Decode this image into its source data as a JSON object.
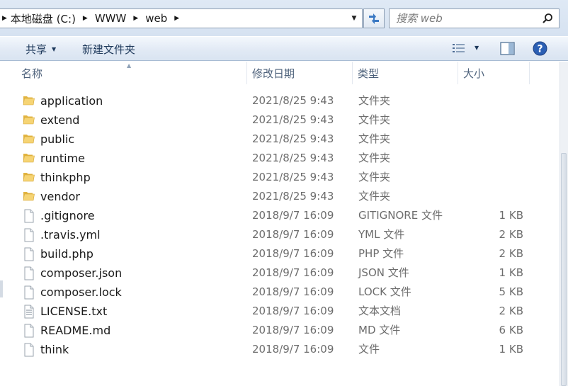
{
  "address_bar": {
    "crumbs": [
      "本地磁盘 (C:)",
      "WWW",
      "web"
    ]
  },
  "search": {
    "placeholder": "搜索 web"
  },
  "toolbar": {
    "share_label": "共享",
    "new_folder_label": "新建文件夹"
  },
  "columns": {
    "name": "名称",
    "date": "修改日期",
    "type": "类型",
    "size": "大小"
  },
  "files": [
    {
      "name": "application",
      "date": "2021/8/25 9:43",
      "type": "文件夹",
      "size": "",
      "icon": "folder-icon"
    },
    {
      "name": "extend",
      "date": "2021/8/25 9:43",
      "type": "文件夹",
      "size": "",
      "icon": "folder-icon"
    },
    {
      "name": "public",
      "date": "2021/8/25 9:43",
      "type": "文件夹",
      "size": "",
      "icon": "folder-icon"
    },
    {
      "name": "runtime",
      "date": "2021/8/25 9:43",
      "type": "文件夹",
      "size": "",
      "icon": "folder-icon"
    },
    {
      "name": "thinkphp",
      "date": "2021/8/25 9:43",
      "type": "文件夹",
      "size": "",
      "icon": "folder-icon"
    },
    {
      "name": "vendor",
      "date": "2021/8/25 9:43",
      "type": "文件夹",
      "size": "",
      "icon": "folder-icon"
    },
    {
      "name": ".gitignore",
      "date": "2018/9/7 16:09",
      "type": "GITIGNORE 文件",
      "size": "1 KB",
      "icon": "file-icon"
    },
    {
      "name": ".travis.yml",
      "date": "2018/9/7 16:09",
      "type": "YML 文件",
      "size": "2 KB",
      "icon": "file-icon"
    },
    {
      "name": "build.php",
      "date": "2018/9/7 16:09",
      "type": "PHP 文件",
      "size": "2 KB",
      "icon": "file-icon"
    },
    {
      "name": "composer.json",
      "date": "2018/9/7 16:09",
      "type": "JSON 文件",
      "size": "1 KB",
      "icon": "file-icon"
    },
    {
      "name": "composer.lock",
      "date": "2018/9/7 16:09",
      "type": "LOCK 文件",
      "size": "5 KB",
      "icon": "file-icon"
    },
    {
      "name": "LICENSE.txt",
      "date": "2018/9/7 16:09",
      "type": "文本文档",
      "size": "2 KB",
      "icon": "text-file-icon"
    },
    {
      "name": "README.md",
      "date": "2018/9/7 16:09",
      "type": "MD 文件",
      "size": "6 KB",
      "icon": "file-icon"
    },
    {
      "name": "think",
      "date": "2018/9/7 16:09",
      "type": "文件",
      "size": "1 KB",
      "icon": "file-icon"
    }
  ]
}
